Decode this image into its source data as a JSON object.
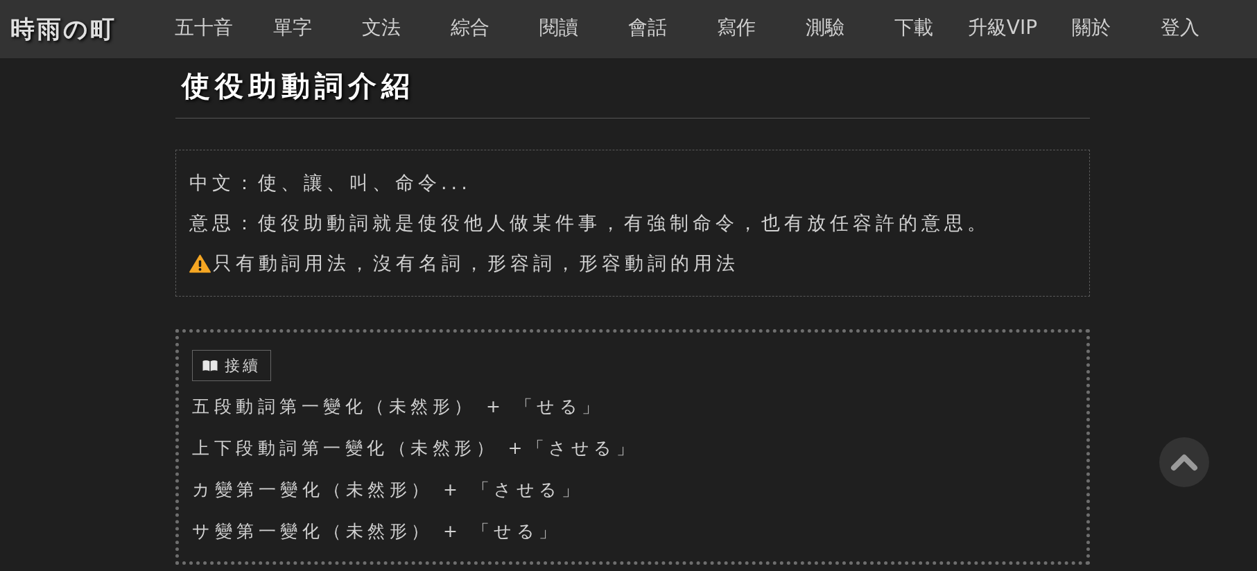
{
  "site": {
    "logo": "時雨の町"
  },
  "nav": {
    "items": [
      {
        "label": "五十音"
      },
      {
        "label": "單字"
      },
      {
        "label": "文法"
      },
      {
        "label": "綜合"
      },
      {
        "label": "閱讀"
      },
      {
        "label": "會話"
      },
      {
        "label": "寫作"
      },
      {
        "label": "測驗"
      },
      {
        "label": "下載"
      },
      {
        "label": "升級VIP"
      },
      {
        "label": "關於"
      },
      {
        "label": "登入"
      }
    ]
  },
  "article": {
    "title": "使役助動詞介紹",
    "info_box": {
      "lines": [
        {
          "kind": "plain",
          "text": "中文：使、讓、叫、命令..."
        },
        {
          "kind": "plain",
          "text": "意思：使役助動詞就是使役他人做某件事，有強制命令，也有放任容許的意思。"
        },
        {
          "kind": "warning",
          "text": "只有動詞用法，沒有名詞，形容詞，形容動詞的用法"
        }
      ]
    },
    "conjugation_box": {
      "tag": "接續",
      "lines": [
        "五段動詞第一變化（未然形） + 「せる」",
        "上下段動詞第一變化（未然形） +「させる」",
        "カ變第一變化（未然形） + 「させる」",
        "サ變第一變化（未然形） + 「せる」"
      ]
    }
  }
}
